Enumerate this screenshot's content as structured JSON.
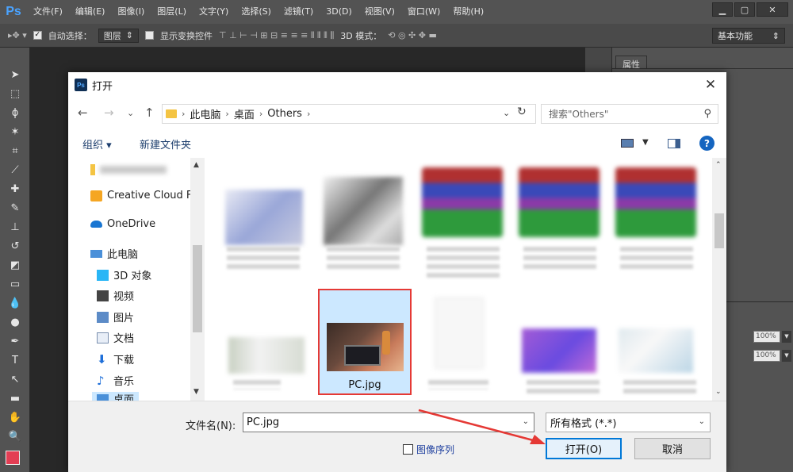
{
  "app": {
    "logo": "Ps",
    "menu": [
      "文件(F)",
      "编辑(E)",
      "图像(I)",
      "图层(L)",
      "文字(Y)",
      "选择(S)",
      "滤镜(T)",
      "3D(D)",
      "视图(V)",
      "窗口(W)",
      "帮助(H)"
    ],
    "window_controls": {
      "minimize": "▁",
      "restore": "▢",
      "close": "✕"
    }
  },
  "options_bar": {
    "auto_select_label": "自动选择：",
    "auto_select_value": "图层",
    "show_transform_label": "显示变换控件",
    "mode_3d_label": "3D 模式：",
    "workspace": "基本功能"
  },
  "right_panel": {
    "tab_label": "属性",
    "opacity_value": "100%",
    "fill_value": "100%"
  },
  "dialog": {
    "title": "打开",
    "breadcrumb": [
      "此电脑",
      "桌面",
      "Others"
    ],
    "search_placeholder": "搜索\"Others\"",
    "toolbar": {
      "organize": "组织 ▾",
      "new_folder": "新建文件夹",
      "help": "?"
    },
    "nav_items": [
      {
        "label": "Creative Cloud F",
        "icon": "creative-cloud-icon"
      },
      {
        "label": "OneDrive",
        "icon": "onedrive-icon"
      },
      {
        "label": "此电脑",
        "icon": "computer-icon"
      },
      {
        "label": "3D 对象",
        "icon": "3d-objects-icon"
      },
      {
        "label": "视频",
        "icon": "video-icon"
      },
      {
        "label": "图片",
        "icon": "pictures-icon"
      },
      {
        "label": "文档",
        "icon": "documents-icon"
      },
      {
        "label": "下载",
        "icon": "download-icon"
      },
      {
        "label": "音乐",
        "icon": "music-icon"
      },
      {
        "label": "桌面",
        "icon": "desktop-icon"
      }
    ],
    "selected_file": "PC.jpg",
    "filename_label": "文件名(N):",
    "filename_value": "PC.jpg",
    "filter_value": "所有格式 (*.*)",
    "image_sequence_label": "图像序列",
    "open_button": "打开(O)",
    "cancel_button": "取消"
  },
  "colors": {
    "foreground": "#e33e54",
    "background": "#ffffff",
    "highlight_border": "#e53935",
    "selection_fill": "#cce8ff",
    "primary_button_border": "#0078d7"
  }
}
